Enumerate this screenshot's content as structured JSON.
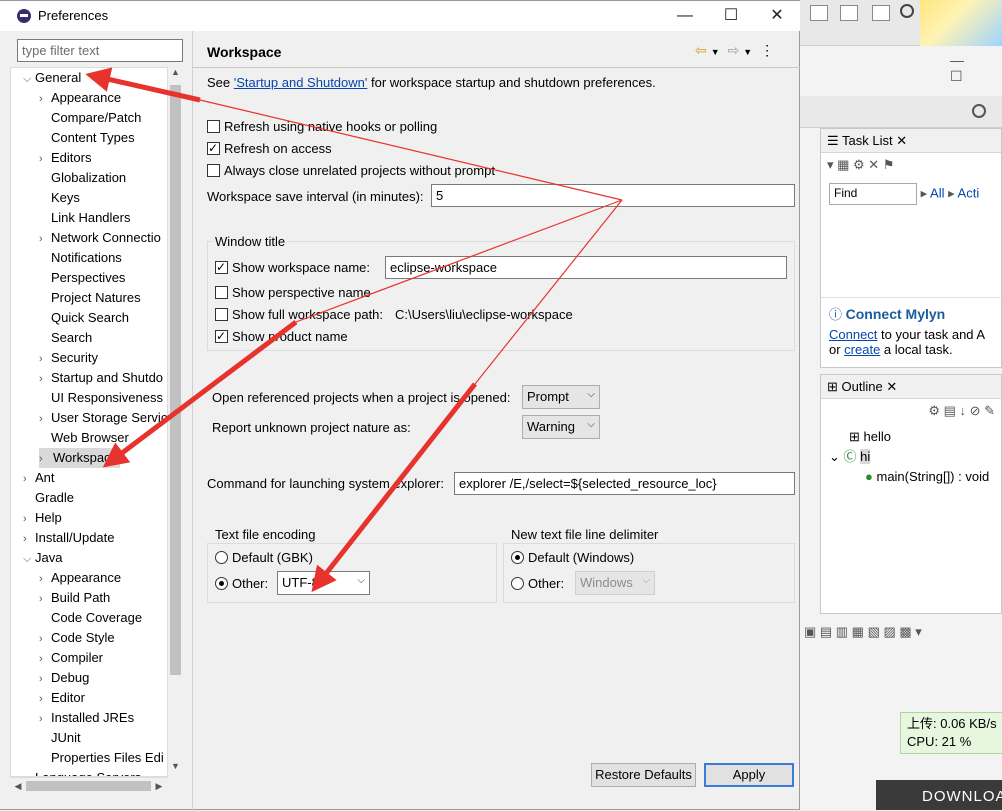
{
  "dialog": {
    "title": "Preferences",
    "filter_placeholder": "type filter text",
    "window_controls": {
      "minimize": "—",
      "maximize": "☐",
      "close": "✕"
    }
  },
  "tree": {
    "items": [
      {
        "label": "General",
        "level": 0,
        "toggle": "expanded"
      },
      {
        "label": "Appearance",
        "level": 1,
        "toggle": "collapsed"
      },
      {
        "label": "Compare/Patch",
        "level": 1,
        "toggle": "none"
      },
      {
        "label": "Content Types",
        "level": 1,
        "toggle": "none"
      },
      {
        "label": "Editors",
        "level": 1,
        "toggle": "collapsed"
      },
      {
        "label": "Globalization",
        "level": 1,
        "toggle": "none"
      },
      {
        "label": "Keys",
        "level": 1,
        "toggle": "none"
      },
      {
        "label": "Link Handlers",
        "level": 1,
        "toggle": "none"
      },
      {
        "label": "Network Connectio",
        "level": 1,
        "toggle": "collapsed"
      },
      {
        "label": "Notifications",
        "level": 1,
        "toggle": "none"
      },
      {
        "label": "Perspectives",
        "level": 1,
        "toggle": "none"
      },
      {
        "label": "Project Natures",
        "level": 1,
        "toggle": "none"
      },
      {
        "label": "Quick Search",
        "level": 1,
        "toggle": "none"
      },
      {
        "label": "Search",
        "level": 1,
        "toggle": "none"
      },
      {
        "label": "Security",
        "level": 1,
        "toggle": "collapsed"
      },
      {
        "label": "Startup and Shutdo",
        "level": 1,
        "toggle": "collapsed"
      },
      {
        "label": "UI Responsiveness",
        "level": 1,
        "toggle": "none"
      },
      {
        "label": "User Storage Servic",
        "level": 1,
        "toggle": "collapsed"
      },
      {
        "label": "Web Browser",
        "level": 1,
        "toggle": "none"
      },
      {
        "label": "Workspace",
        "level": 1,
        "toggle": "collapsed",
        "selected": true
      },
      {
        "label": "Ant",
        "level": 0,
        "toggle": "collapsed"
      },
      {
        "label": "Gradle",
        "level": 0,
        "toggle": "none"
      },
      {
        "label": "Help",
        "level": 0,
        "toggle": "collapsed"
      },
      {
        "label": "Install/Update",
        "level": 0,
        "toggle": "collapsed"
      },
      {
        "label": "Java",
        "level": 0,
        "toggle": "expanded"
      },
      {
        "label": "Appearance",
        "level": 1,
        "toggle": "collapsed"
      },
      {
        "label": "Build Path",
        "level": 1,
        "toggle": "collapsed"
      },
      {
        "label": "Code Coverage",
        "level": 1,
        "toggle": "none"
      },
      {
        "label": "Code Style",
        "level": 1,
        "toggle": "collapsed"
      },
      {
        "label": "Compiler",
        "level": 1,
        "toggle": "collapsed"
      },
      {
        "label": "Debug",
        "level": 1,
        "toggle": "collapsed"
      },
      {
        "label": "Editor",
        "level": 1,
        "toggle": "collapsed"
      },
      {
        "label": "Installed JREs",
        "level": 1,
        "toggle": "collapsed"
      },
      {
        "label": "JUnit",
        "level": 1,
        "toggle": "none"
      },
      {
        "label": "Properties Files Edi",
        "level": 1,
        "toggle": "none"
      },
      {
        "label": "Language Servers",
        "level": 0,
        "toggle": "collapsed"
      }
    ]
  },
  "page": {
    "title": "Workspace",
    "see_prefix": "See ",
    "see_link": "'Startup and Shutdown'",
    "see_suffix": " for workspace startup and shutdown preferences.",
    "refresh_native": {
      "label": "Refresh using native hooks or polling",
      "checked": false
    },
    "refresh_access": {
      "label": "Refresh on access",
      "checked": true
    },
    "always_close": {
      "label": "Always close unrelated projects without prompt",
      "checked": false
    },
    "save_interval_label": "Workspace save interval (in minutes):",
    "save_interval_value": "5",
    "window_title_group": "Window title",
    "show_ws_name": {
      "label": "Show workspace name:",
      "checked": true,
      "value": "eclipse-workspace"
    },
    "show_perspective": {
      "label": "Show perspective name",
      "checked": false
    },
    "show_full_path": {
      "label": "Show full workspace path:",
      "checked": false,
      "value": "C:\\Users\\liu\\eclipse-workspace"
    },
    "show_product": {
      "label": "Show product name",
      "checked": true
    },
    "open_ref_label": "Open referenced projects when a project is opened:",
    "open_ref_value": "Prompt",
    "report_unknown_label": "Report unknown project nature as:",
    "report_unknown_value": "Warning",
    "cmd_label": "Command for launching system explorer:",
    "cmd_value": "explorer /E,/select=${selected_resource_loc}",
    "encoding_group": "Text file encoding",
    "encoding_default": "Default (GBK)",
    "encoding_other": "Other:",
    "encoding_value": "UTF-8",
    "delimiter_group": "New text file line delimiter",
    "delimiter_default": "Default (Windows)",
    "delimiter_other": "Other:",
    "delimiter_value": "Windows",
    "restore_defaults": "Restore Defaults",
    "apply": "Apply"
  },
  "background": {
    "task_list": "Task List",
    "find_placeholder": "Find",
    "all": "All",
    "acti": "Acti",
    "connect_mylyn": "Connect Mylyn",
    "connect_link": "Connect",
    "connect_text": " to your task and A",
    "or_text": "or ",
    "create_link": "create",
    "local_task": " a local task.",
    "outline": "Outline",
    "outline_hello": "hello",
    "outline_hi": "hi",
    "outline_main": "main(String[]) : void",
    "upload": "上传: 0.06 KB/s",
    "cpu": "CPU: 21 %",
    "download": "DOWNLOA"
  },
  "annotation_color": "#e8322e"
}
